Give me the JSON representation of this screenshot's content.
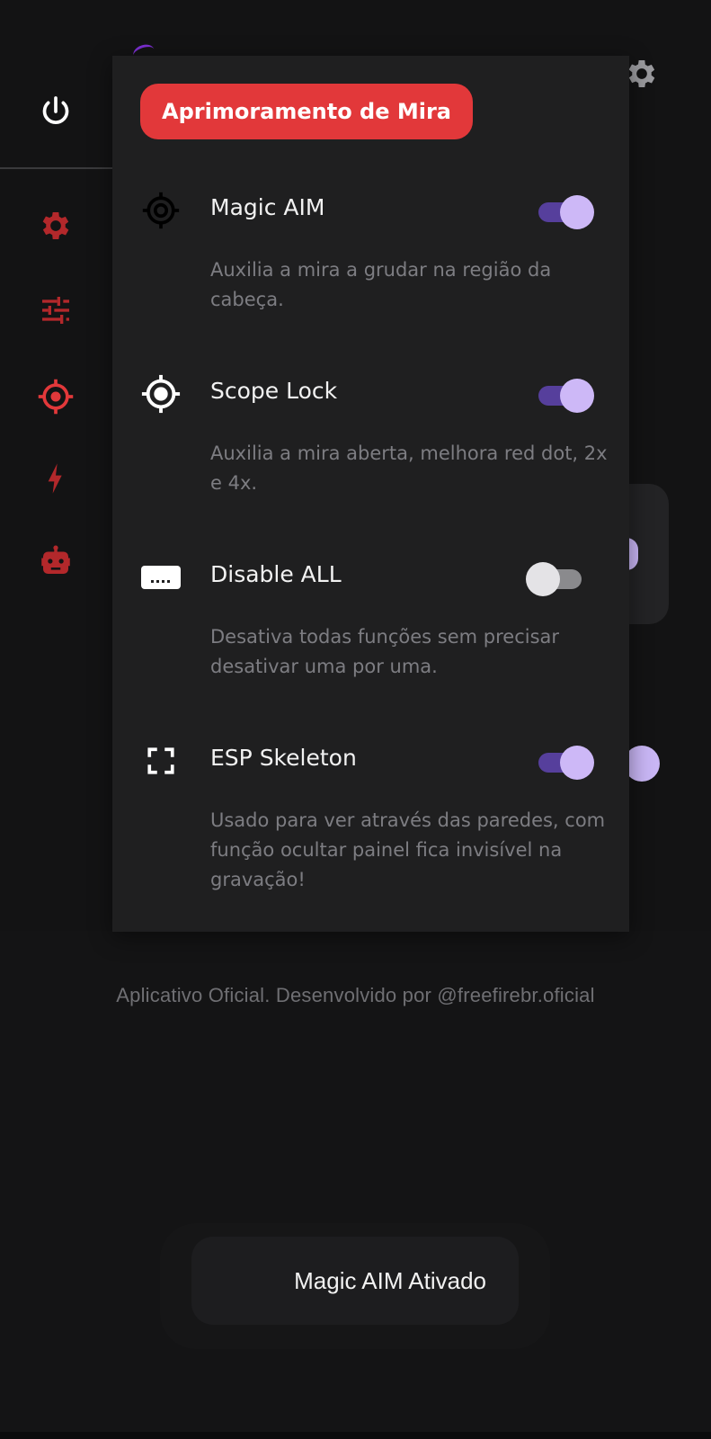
{
  "panel": {
    "title": "Aprimoramento de Mira",
    "options": [
      {
        "label": "Magic AIM",
        "description": "Auxilia a mira a grudar na região da cabeça.",
        "enabled": true,
        "icon": "crosshair-icon"
      },
      {
        "label": "Scope Lock",
        "description": "Auxilia a mira aberta, melhora red dot, 2x e 4x.",
        "enabled": true,
        "icon": "gps-fixed-icon"
      },
      {
        "label": "Disable ALL",
        "description": "Desativa todas funções sem precisar desativar uma por uma.",
        "enabled": false,
        "icon": "keyboard-spacebar-icon"
      },
      {
        "label": "ESP Skeleton",
        "description": "Usado para ver através das paredes, com função ocultar painel fica invisível na gravação!",
        "enabled": true,
        "icon": "fullscreen-icon"
      }
    ]
  },
  "sidebar": {
    "icons": [
      "power-icon",
      "settings-icon",
      "sliders-icon",
      "target-icon",
      "bolt-icon",
      "robot-icon"
    ]
  },
  "footer": {
    "text": "Aplicativo Oficial. Desenvolvido por @freefirebr.oficial"
  },
  "toast": {
    "text": "Magic AIM Ativado"
  },
  "colors": {
    "accent_red": "#e2383a",
    "toggle_on_track": "#563f9c",
    "toggle_on_knob": "#cdb8f7",
    "icon_red": "#b3282b"
  }
}
